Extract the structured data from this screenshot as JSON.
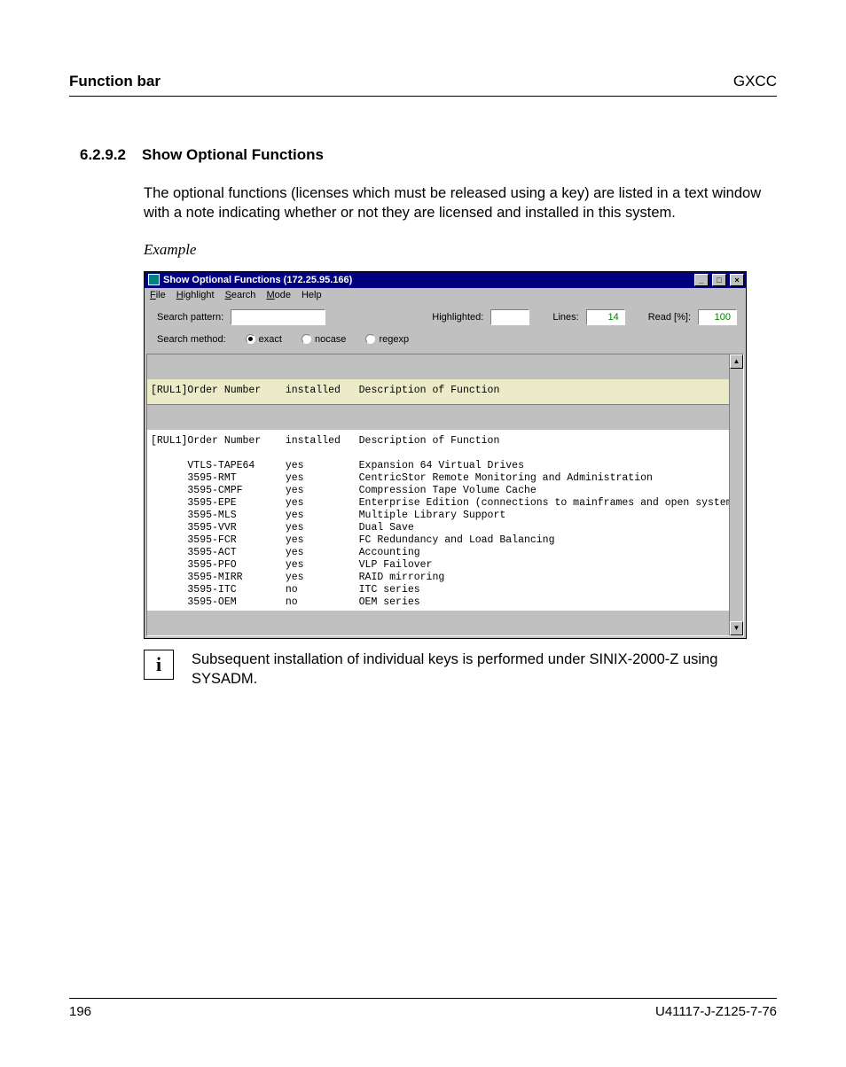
{
  "page": {
    "header_left": "Function bar",
    "header_right": "GXCC",
    "section_number": "6.2.9.2",
    "section_title": "Show Optional Functions",
    "paragraph": "The optional functions (licenses which must be released using a key) are listed in a text window with a note indicating whether or not they are licensed and installed in this system.",
    "example_label": "Example",
    "note_text": "Subsequent installation of individual keys is performed under SINIX-2000-Z using SYSADM.",
    "info_glyph": "i",
    "page_number": "196",
    "doc_id": "U41117-J-Z125-7-76"
  },
  "window": {
    "title": "Show Optional Functions (172.25.95.166)",
    "menus": [
      "File",
      "Highlight",
      "Search",
      "Mode",
      "Help"
    ],
    "labels": {
      "search_pattern": "Search pattern:",
      "highlighted": "Highlighted:",
      "lines": "Lines:",
      "read_pct": "Read [%]:",
      "search_method": "Search method:",
      "exact": "exact",
      "nocase": "nocase",
      "regexp": "regexp"
    },
    "values": {
      "highlighted": "",
      "lines": "14",
      "read_pct": "100"
    },
    "columns_header": "[RUL1]Order Number    installed   Description of Function",
    "rows": [
      {
        "order": "VTLS-TAPE64",
        "installed": "yes",
        "desc": "Expansion 64 Virtual Drives"
      },
      {
        "order": "3595-RMT",
        "installed": "yes",
        "desc": "CentricStor Remote Monitoring and Administration"
      },
      {
        "order": "3595-CMPF",
        "installed": "yes",
        "desc": "Compression Tape Volume Cache"
      },
      {
        "order": "3595-EPE",
        "installed": "yes",
        "desc": "Enterprise Edition (connections to mainframes and open systems)"
      },
      {
        "order": "3595-MLS",
        "installed": "yes",
        "desc": "Multiple Library Support"
      },
      {
        "order": "3595-VVR",
        "installed": "yes",
        "desc": "Dual Save"
      },
      {
        "order": "3595-FCR",
        "installed": "yes",
        "desc": "FC Redundancy and Load Balancing"
      },
      {
        "order": "3595-ACT",
        "installed": "yes",
        "desc": "Accounting"
      },
      {
        "order": "3595-PFO",
        "installed": "yes",
        "desc": "VLP Failover"
      },
      {
        "order": "3595-MIRR",
        "installed": "yes",
        "desc": "RAID mirroring"
      },
      {
        "order": "3595-ITC",
        "installed": "no",
        "desc": "ITC series"
      },
      {
        "order": "3595-OEM",
        "installed": "no",
        "desc": "OEM series"
      }
    ]
  }
}
